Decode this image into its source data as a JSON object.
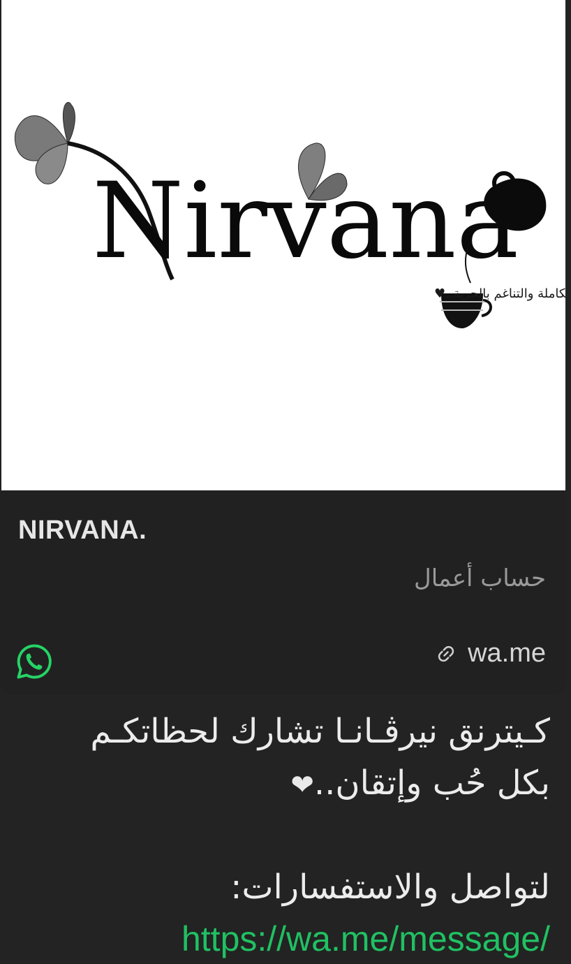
{
  "preview": {
    "image": {
      "logo_text": "Nirvana",
      "tagline": "حالة من السعادة الكاملة والتناغم بالحرية..♥"
    },
    "title": "NIRVANA.",
    "subtitle": "حساب أعمال",
    "domain": "wa.me",
    "icons": {
      "link": "link-icon",
      "whatsapp": "whatsapp-icon"
    }
  },
  "message": {
    "line1": "كـيترنق نيرڤـانـا تشارك لحظاتكـم",
    "line2": "بكل حُب وإتقان..",
    "line2_emoji": "❤",
    "line3": "لتواصل والاستفسارات:",
    "link": "https://wa.me/message/"
  },
  "colors": {
    "background": "#222322",
    "card": "#212121",
    "link": "#21c063",
    "whatsapp": "#25d366"
  }
}
